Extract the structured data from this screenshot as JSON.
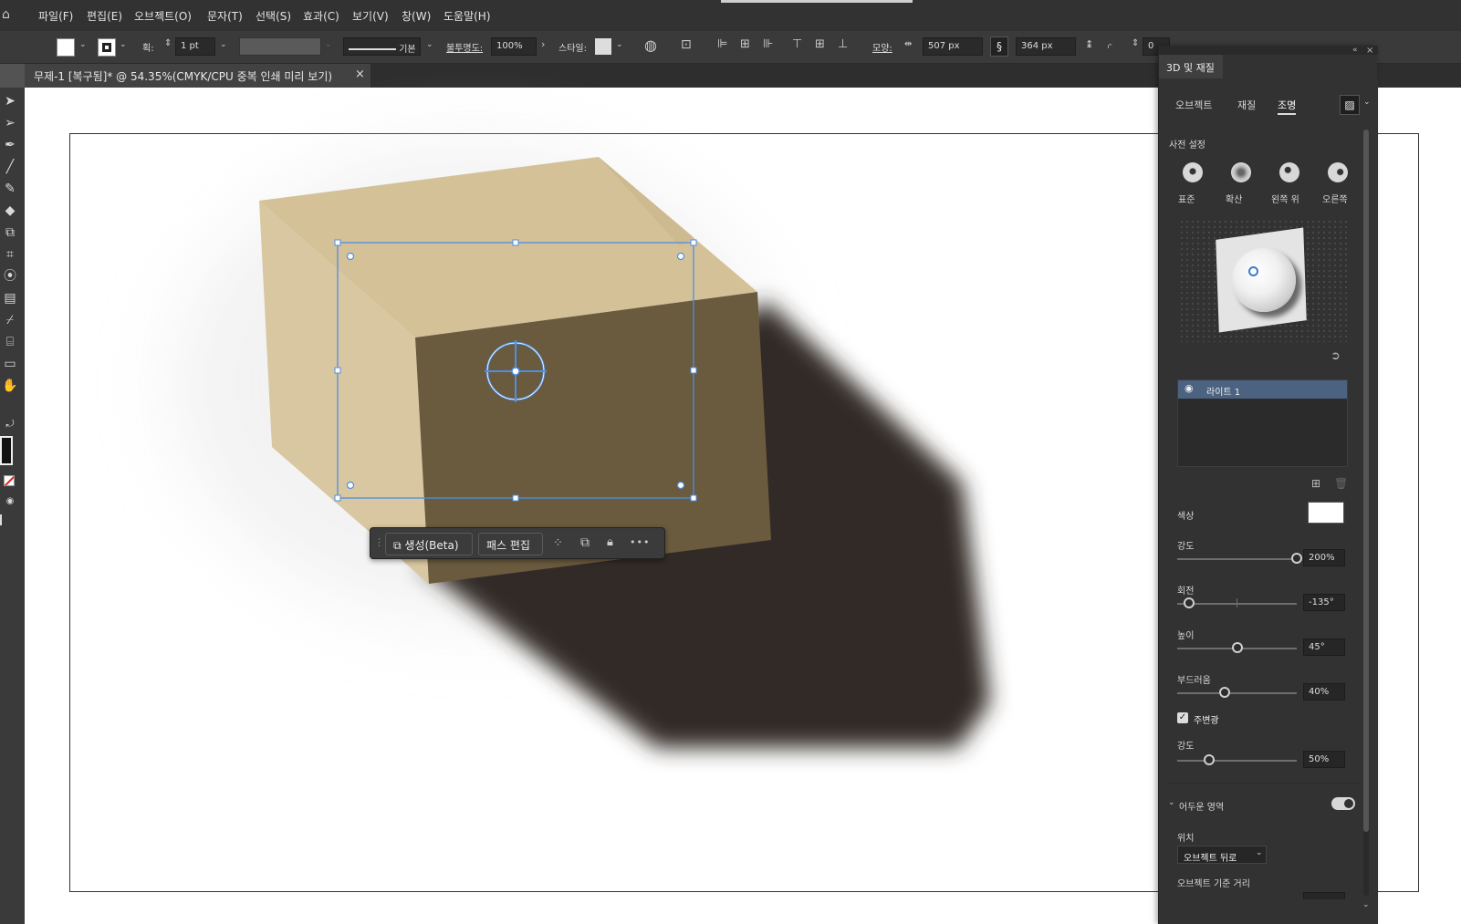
{
  "menubar": {
    "items": [
      "파일(F)",
      "편집(E)",
      "오브젝트(O)",
      "문자(T)",
      "선택(S)",
      "효과(C)",
      "보기(V)",
      "창(W)",
      "도움말(H)"
    ]
  },
  "control_bar": {
    "stroke_label": "획:",
    "stroke_weight": "1 pt",
    "stroke_style": "기본",
    "opacity_label": "불투명도:",
    "opacity_value": "100%",
    "style_label": "스타일:",
    "shape_label": "모양:",
    "width_value": "507 px",
    "height_value": "364 px",
    "corner_value": "0"
  },
  "document": {
    "tab_title": "무제-1 [복구됨]* @ 54.35%(CMYK/CPU 중복 인쇄 미리 보기)",
    "close_glyph": "×"
  },
  "context_bar": {
    "generate_label": "생성(Beta)",
    "path_edit_label": "패스 편집",
    "more_glyph": "•••"
  },
  "panel": {
    "title": "3D 및 재질",
    "tabs": [
      "오브젝트",
      "재질",
      "조명"
    ],
    "active_tab": "조명",
    "presets_heading": "사전 설정",
    "presets": [
      "표준",
      "확산",
      "왼쪽 위",
      "오른쪽"
    ],
    "light_list": [
      "라이트 1"
    ],
    "color_label": "색상",
    "color_value": "#ffffff",
    "intensity_label": "강도",
    "intensity_value": "200%",
    "intensity_level": 1.0,
    "rotation_label": "회전",
    "rotation_value": "-135°",
    "rotation_level": 0.1,
    "height_label": "높이",
    "height_value": "45°",
    "height_level": 0.5,
    "softness_label": "부드러움",
    "softness_value": "40%",
    "softness_level": 0.4,
    "ambient_label": "주변광",
    "ambient_checked": true,
    "ambient_intensity_label": "강도",
    "ambient_intensity_value": "50%",
    "ambient_level": 0.27,
    "shadows_label": "어두운 영역",
    "shadows_on": true,
    "position_label": "위치",
    "position_value": "오브젝트 뒤로",
    "distance_label": "오브젝트 기준 거리"
  },
  "colors": {
    "accent": "#3b7bd4",
    "cube_top": "#d4c198",
    "cube_front": "#d7c59e",
    "cube_side": "#6a5a3e",
    "shadow": "#2f2a26"
  }
}
